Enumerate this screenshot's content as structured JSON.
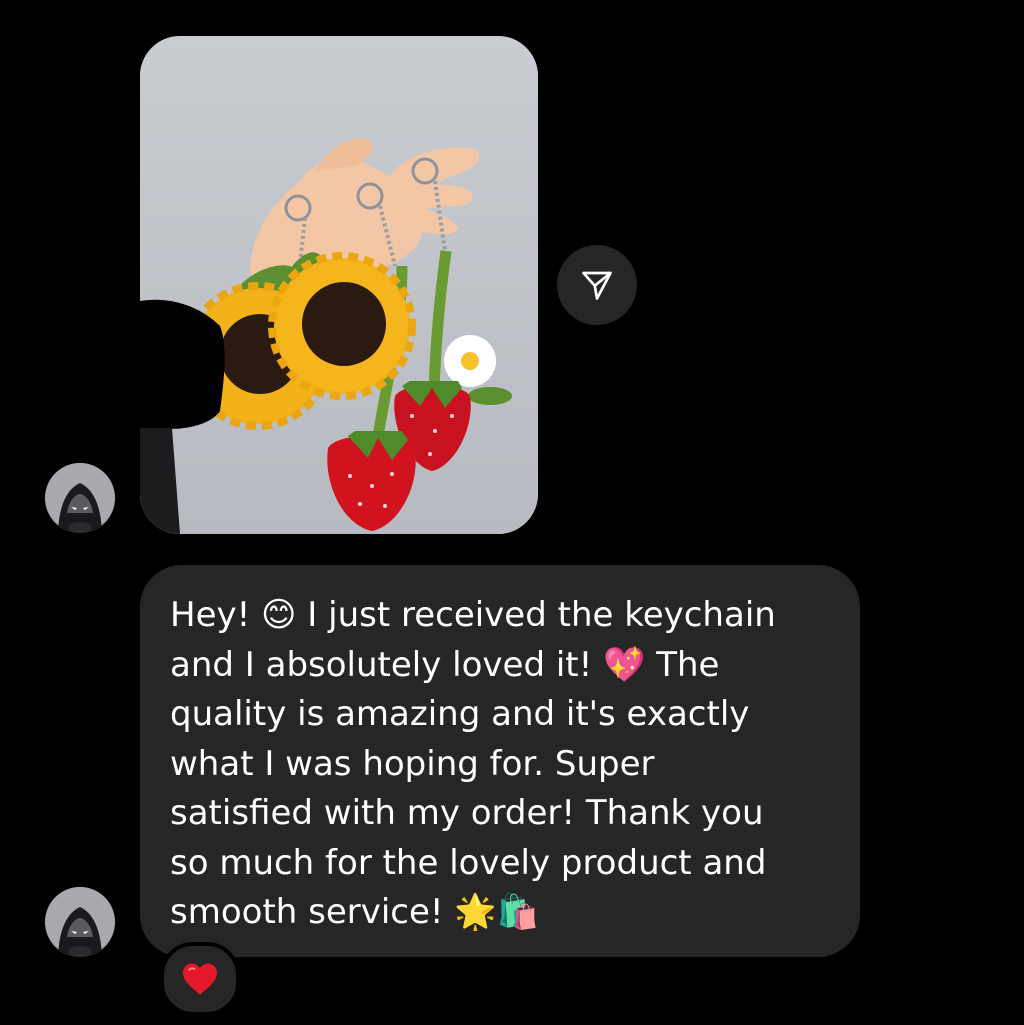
{
  "conversation": {
    "image_message": {
      "alt": "",
      "colors": {
        "background": "#c4c7cc",
        "sunflower_petal": "#f3b21a",
        "sunflower_center": "#2b1a12",
        "strawberry": "#c8121f",
        "leaf": "#5b8f2f"
      }
    },
    "share_button": {
      "icon": "paper-plane-icon"
    },
    "text_message": {
      "text": "Hey! 😊 I just received the keychain\nand I absolutely loved it! 💖 The\nquality is amazing and it's exactly\nwhat I was hoping for. Super\nsatisfied with my order! Thank you\nso much for the lovely product and\nsmooth service! 🌟🛍️"
    },
    "reaction": {
      "emoji": "❤️",
      "color": "#e3192b"
    },
    "avatars": [
      {
        "icon": "hooded-character-avatar"
      },
      {
        "icon": "hooded-character-avatar"
      }
    ]
  },
  "theme": {
    "background": "#000000",
    "bubble": "#262626",
    "text": "#ffffff"
  }
}
